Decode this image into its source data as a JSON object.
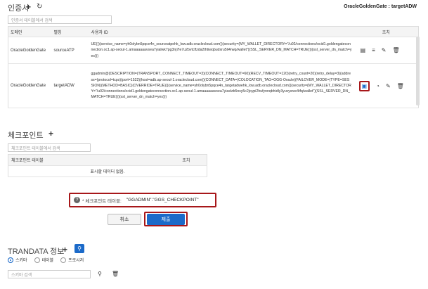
{
  "credentials": {
    "title": "인증서",
    "search_placeholder": "인증서 테이블에서 검색",
    "context_label": "OracleGoldenGate : targetADW",
    "columns": [
      "도메인",
      "별칭",
      "사용자 ID",
      "조치"
    ],
    "rows": [
      {
        "domain": "OracleGoldenGate",
        "alias": "sourceATP",
        "userid": "UE)))(service_name=yh0olybn5pqce4n_sourceatpehk_low.adb.oraclecloud.com))(security=(MY_WALLET_DIRECTORY=\"/u02/connections/ocid1.goldengateconnection.oc1.ap-seoul-1.amaaaaaavsea7yialwk7pg3nj7le7u2bvtclfzda2thtiwqbudxru5li4rwq/wallet\")(SSL_SERVER_DN_MATCH=TRUE)))(ssl_server_dn_match=yes)))"
      },
      {
        "domain": "OracleGoldenGate",
        "alias": "targetADW",
        "userid": "ggadmin@(DESCRIPTION=(TRANSPORT_CONNECT_TIMEOUT=3)(CONNECT_TIMEOUT=60)(RECV_TIMEOUT=120)(retry_count=20)(retry_delay=3)(address=(protocol=tcps)(port=1522)(host=adb.ap-seoul-1.oraclecloud.com))(CONNECT_DATA=(COLOCATION_TAG=OGG-Oracle)(FAILOVER_MODE=(TYPE=SESSION)(METHOD=BASIC)(OVERRIDE=TRUE)))(service_name=yh0olybn5pqce4n_targetadwehk_low.adb.oraclecloud.com))(security=(MY_WALLET_DIRECTORY=\"/u02/connections/ocid1.goldengateconnection.oc1.ap-seoul-1.amaaaaaavsea7yiaxlzb5nsy5c2joypi2hufynnqbhidly3yuvywve4tfq/wallet\")(SSL_SERVER_DN_MATCH=TRUE)))(ssl_server_dn_match=yes)))"
      }
    ]
  },
  "checkpoint": {
    "title": "체크포인트",
    "search_placeholder": "체크포인트 테이블에서 검색",
    "col_table": "체크포인트 테이블",
    "col_action": "조치",
    "empty_text": "표시할 데이터 없음.",
    "field_label": "* 체크포인트 테이블:",
    "field_value": "\"GGADMIN\".\"GGS_CHECKPOINT\"",
    "cancel_label": "취소",
    "submit_label": "제출"
  },
  "trandata": {
    "title": "TRANDATA 정보",
    "options": [
      "스키마",
      "테이블",
      "프로시저"
    ],
    "selected": "스키마",
    "search_placeholder": "스키마 검색"
  },
  "colors": {
    "accent": "#1b6ac9",
    "highlight": "#a7171a"
  }
}
